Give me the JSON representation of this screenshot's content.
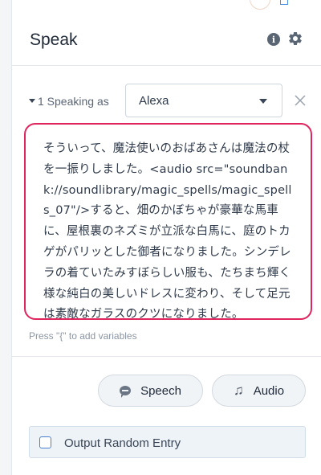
{
  "header": {
    "title": "Speak"
  },
  "speaking": {
    "index_label": "1 Speaking as",
    "voice": "Alexa"
  },
  "editor": {
    "text": "そういって、魔法使いのおばあさんは魔法の杖を一振りしました。<audio src=\"soundbank://soundlibrary/magic_spells/magic_spells_07\"/>すると、畑のかぼちゃが豪華な馬車に、屋根裏のネズミが立派な白馬に、庭のトカゲがパリッとした御者になりました。シンデレラの着ていたみすぼらしい服も、たちまち輝く様な純白の美しいドレスに変わり、そして足元は素敵なガラスのクツになりました。",
    "hint": "Press \"{\" to add variables"
  },
  "buttons": {
    "speech": "Speech",
    "audio": "Audio"
  },
  "options": {
    "random_entry": "Output Random Entry"
  },
  "colors": {
    "highlight_border": "#e0245e",
    "checkbox_border": "#4a7fd0"
  },
  "icons": [
    "info-icon",
    "gear-icon",
    "caret-down-icon",
    "close-icon",
    "speech-icon",
    "music-note-icon"
  ]
}
